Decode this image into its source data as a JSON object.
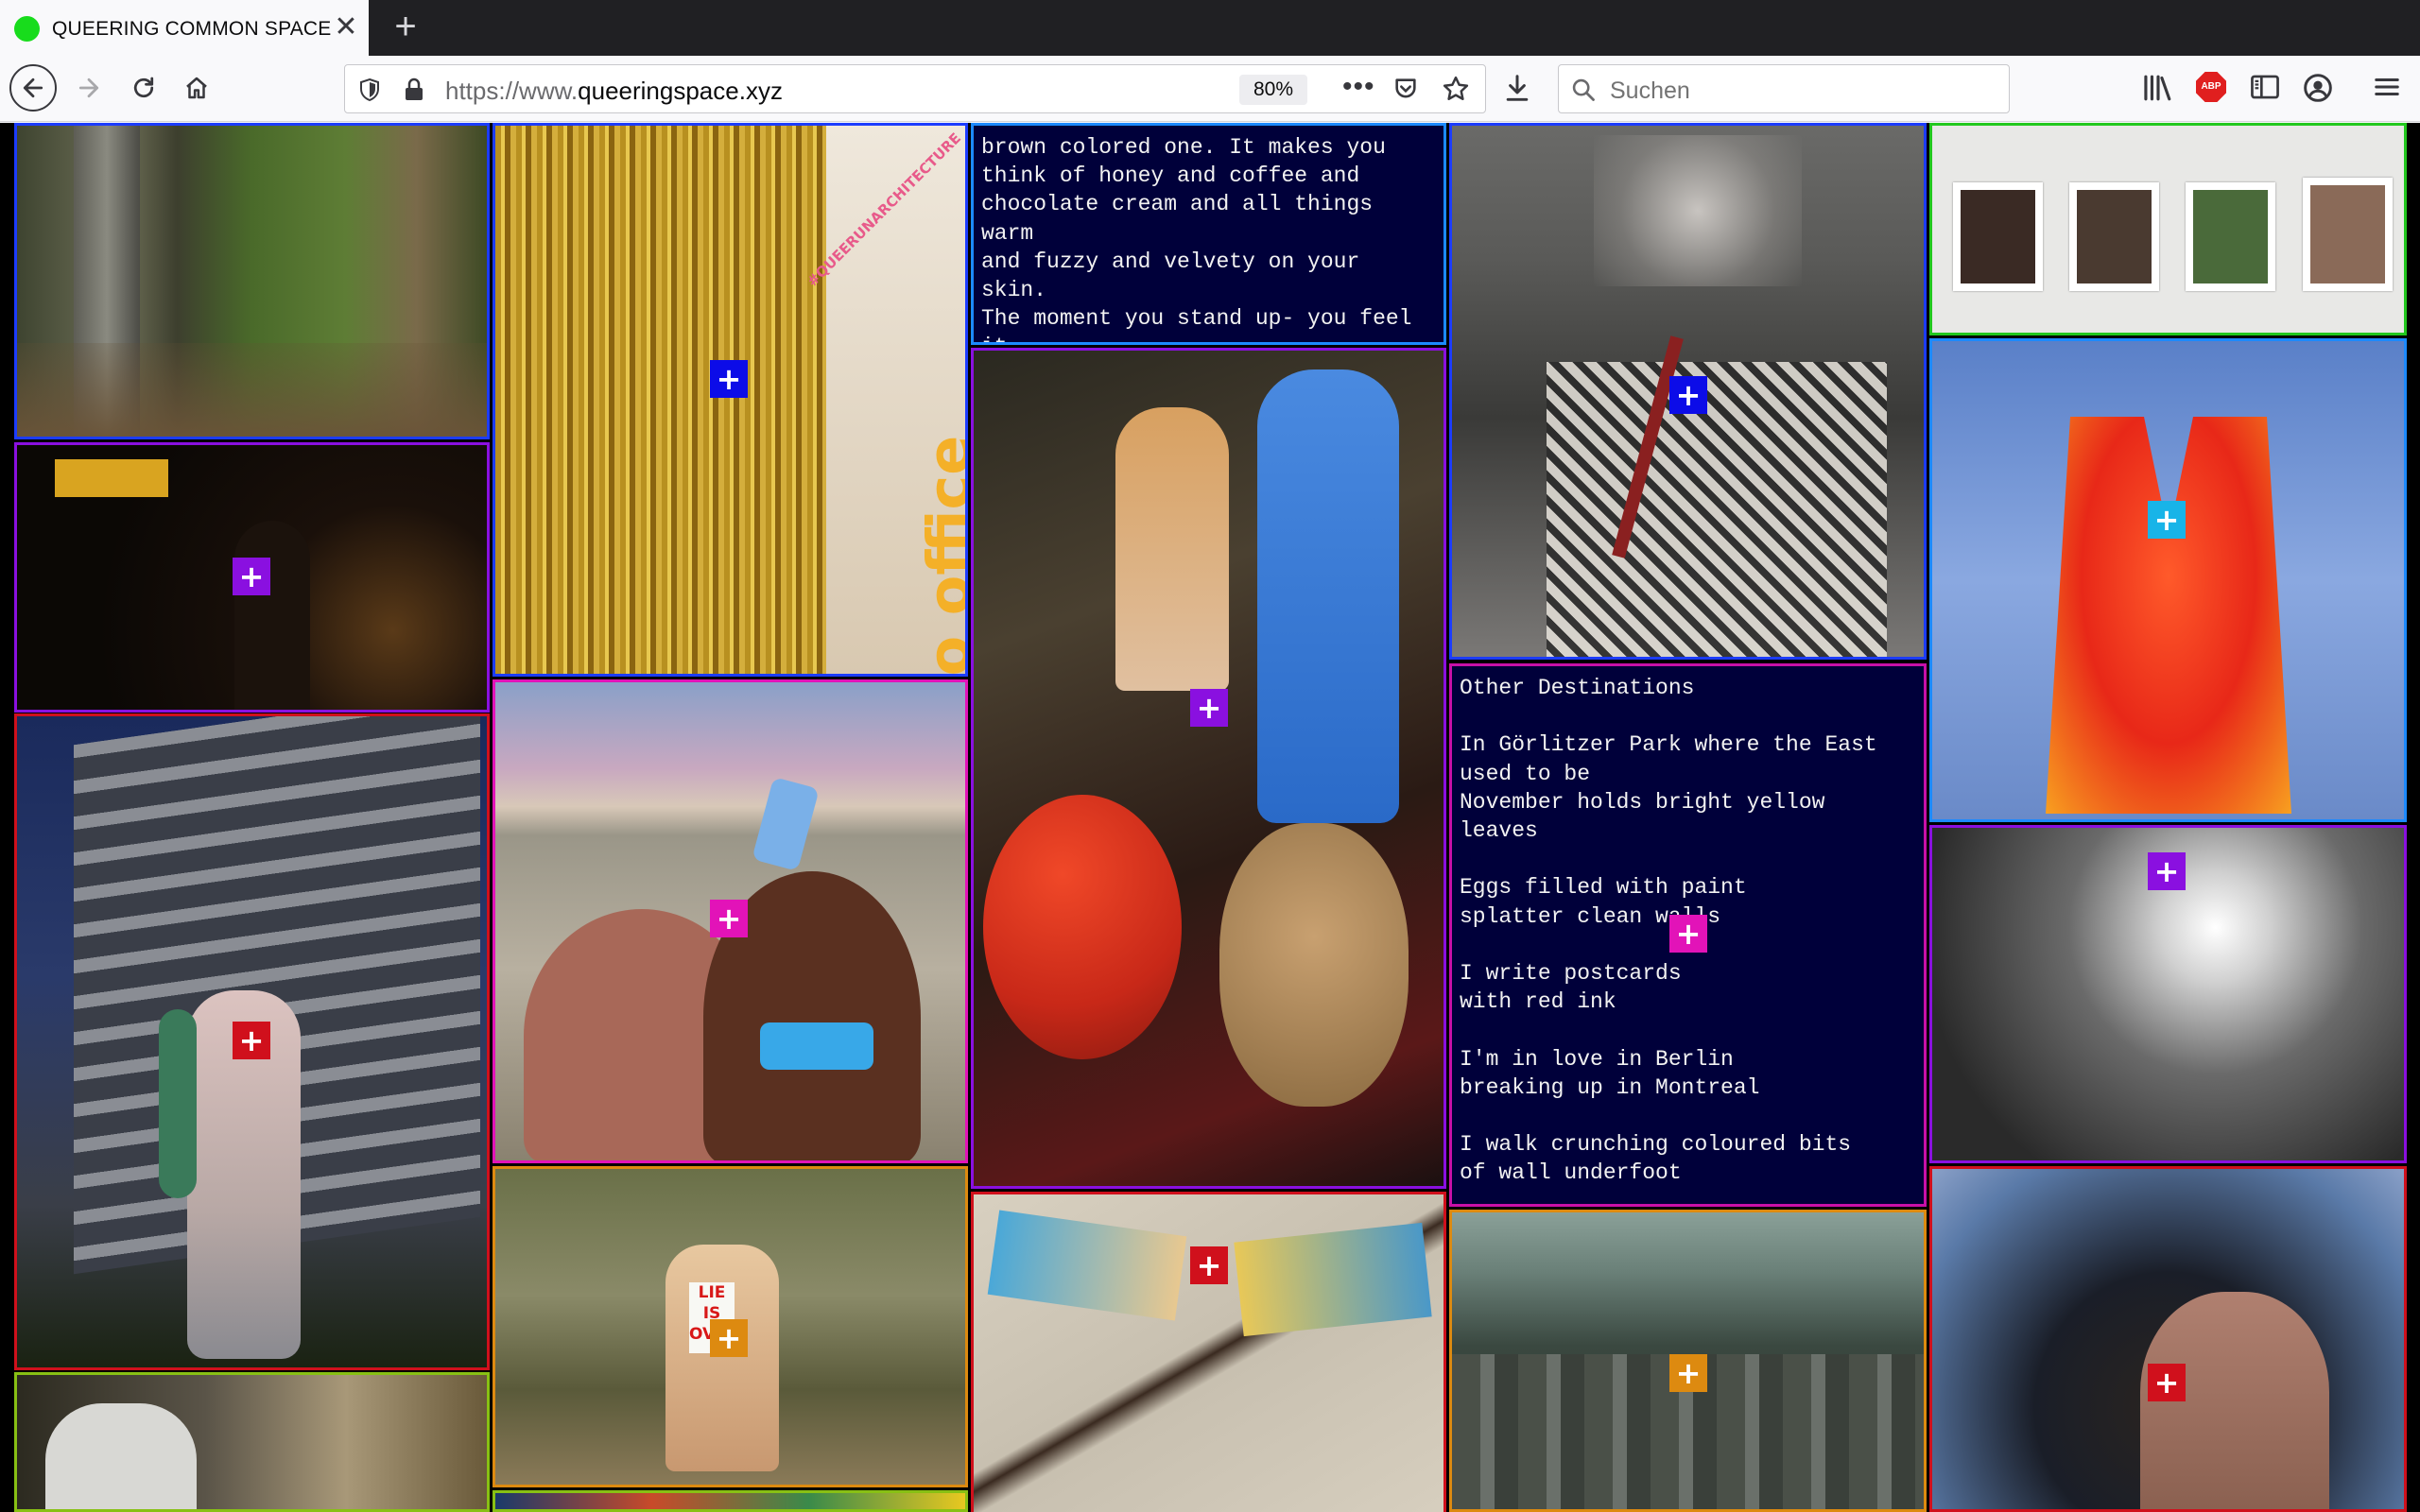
{
  "browser": {
    "tab_title": "QUEERING COMMON SPACE",
    "tab_close": "✕",
    "new_tab": "+",
    "url_prefix": "https://www.",
    "url_domain": "queeringspace.xyz",
    "zoom": "80%",
    "search_placeholder": "Suchen",
    "abp_label": "ABP"
  },
  "colors": {
    "blue": "#0c0ce8",
    "purple": "#8a10e0",
    "magenta": "#e213b8",
    "red": "#d0101c",
    "orange": "#dd8a10",
    "cyan": "#18b4e8"
  },
  "tiles": {
    "poem_1": "brown colored one. It makes you\nthink of honey and coffee and\nchocolate cream and all things warm\nand fuzzy and velvety on your skin.\nThe moment you stand up- you feel it\nin your shins. But I sat, so all was\ngood.",
    "poem_2": "Other Destinations\n\nIn Görlitzer Park where the East\nused to be\nNovember holds bright yellow leaves\n\nEggs filled with paint\nsplatter clean walls\n\nI write postcards\nwith red ink\n\nI'm in love in Berlin\nbreaking up in Montreal\n\nI walk crunching coloured bits\nof wall underfoot\n\nClimb a watchtower",
    "disco_text": "My disco office",
    "disco_hashtag": "#QUEERUNARCHITECTURE",
    "sign_text": "LIE\nIS\nOVER",
    "plus_glyph": "+"
  }
}
